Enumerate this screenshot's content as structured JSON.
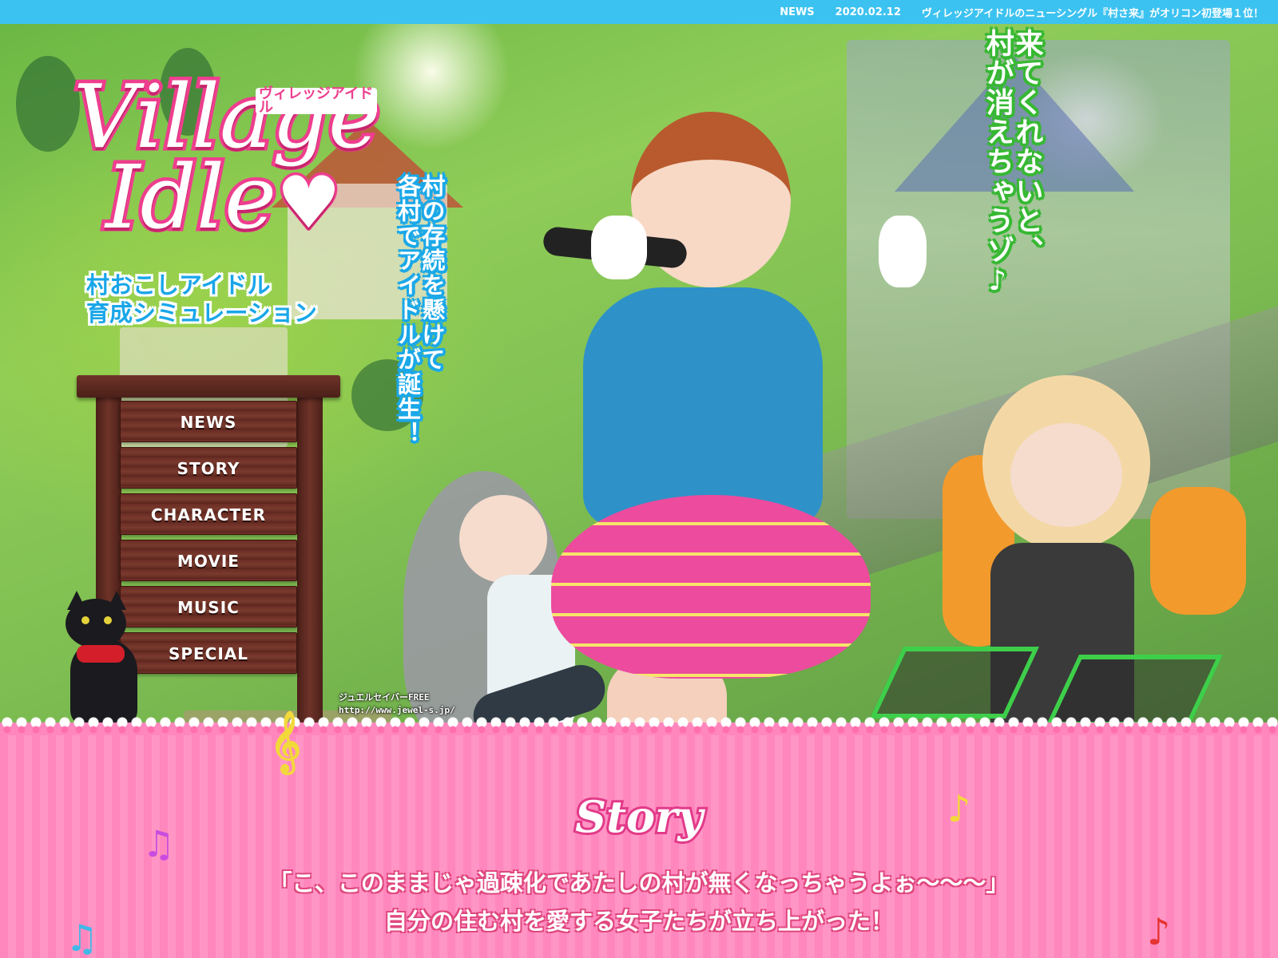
{
  "newsbar": {
    "label": "NEWS",
    "date": "2020.02.12",
    "headline": "ヴィレッジアイドルのニューシングル『村さ来』がオリコン初登場１位！"
  },
  "logo": {
    "line1": "Village",
    "line2": "Idle",
    "heart": "♥",
    "kana": "ヴィレッジアイドル"
  },
  "tagline": {
    "line1": "村おこしアイドル",
    "line2": "育成シミュレーション"
  },
  "nav": {
    "items": [
      {
        "label": "NEWS"
      },
      {
        "label": "STORY"
      },
      {
        "label": "CHARACTER"
      },
      {
        "label": "MOVIE"
      },
      {
        "label": "MUSIC"
      },
      {
        "label": "SPECIAL"
      }
    ]
  },
  "catch_blue": {
    "col1": "村の存続を懸けて",
    "col2": "各村でアイドルが誕生！"
  },
  "catch_green": {
    "col1": "来てくれないと、",
    "col2": "村が消えちゃうゾ♪"
  },
  "credit": {
    "line1": "ジュエルセイバーFREE",
    "line2": "http://www.jewel-s.jp/"
  },
  "story": {
    "title": "Story",
    "line1": "「こ、このままじゃ過疎化であたしの村が無くなっちゃうよぉ〜〜〜」",
    "line2": "自分の住む村を愛する女子たちが立ち上がった！"
  },
  "notes": {
    "treble": "𝄞",
    "eighth": "♪",
    "beamed": "♫"
  },
  "colors": {
    "newsbar": "#3cc2f0",
    "pink": "#ee3e8e",
    "blue_text": "#19a6e8",
    "green_text": "#37b833",
    "story_bg": "#ff87bd"
  }
}
